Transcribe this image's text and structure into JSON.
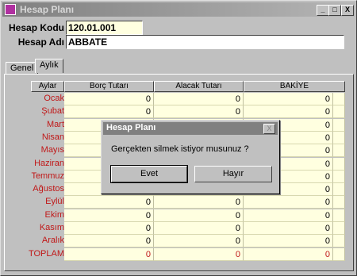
{
  "window": {
    "title": "Hesap Planı",
    "min": "_",
    "max": "□",
    "close": "X"
  },
  "form": {
    "code_label": "Hesap Kodu",
    "code_value": "120.01.001",
    "name_label": "Hesap Adı",
    "name_value": "ABBATE"
  },
  "tabs": [
    {
      "label": "Genel"
    },
    {
      "label": "Aylık"
    }
  ],
  "table": {
    "headers": [
      "Aylar",
      "Borç Tutarı",
      "Alacak Tutarı",
      "BAKİYE"
    ],
    "rows": [
      {
        "month": "Ocak",
        "borc": "0",
        "alacak": "0",
        "bakiye": "0"
      },
      {
        "month": "Şubat",
        "borc": "0",
        "alacak": "0",
        "bakiye": "0"
      },
      {
        "month": "Mart",
        "borc": "",
        "alacak": "",
        "bakiye": "0"
      },
      {
        "month": "Nisan",
        "borc": "",
        "alacak": "",
        "bakiye": "0"
      },
      {
        "month": "Mayıs",
        "borc": "",
        "alacak": "",
        "bakiye": "0"
      },
      {
        "month": "Haziran",
        "borc": "",
        "alacak": "",
        "bakiye": "0"
      },
      {
        "month": "Temmuz",
        "borc": "",
        "alacak": "",
        "bakiye": "0"
      },
      {
        "month": "Ağustos",
        "borc": "",
        "alacak": "",
        "bakiye": "0"
      },
      {
        "month": "Eylül",
        "borc": "0",
        "alacak": "0",
        "bakiye": "0"
      },
      {
        "month": "Ekim",
        "borc": "0",
        "alacak": "0",
        "bakiye": "0"
      },
      {
        "month": "Kasım",
        "borc": "0",
        "alacak": "0",
        "bakiye": "0"
      },
      {
        "month": "Aralık",
        "borc": "0",
        "alacak": "0",
        "bakiye": "0"
      }
    ],
    "total": {
      "month": "TOPLAM",
      "borc": "0",
      "alacak": "0",
      "bakiye": "0"
    }
  },
  "dialog": {
    "title": "Hesap Planı",
    "message": "Gerçekten silmek istiyor musunuz ?",
    "yes": "Evet",
    "no": "Hayır",
    "close": "X"
  },
  "colors": {
    "month_label": "#c01818",
    "cell_bg": "#ffffe0",
    "title_bar": "#808080"
  }
}
